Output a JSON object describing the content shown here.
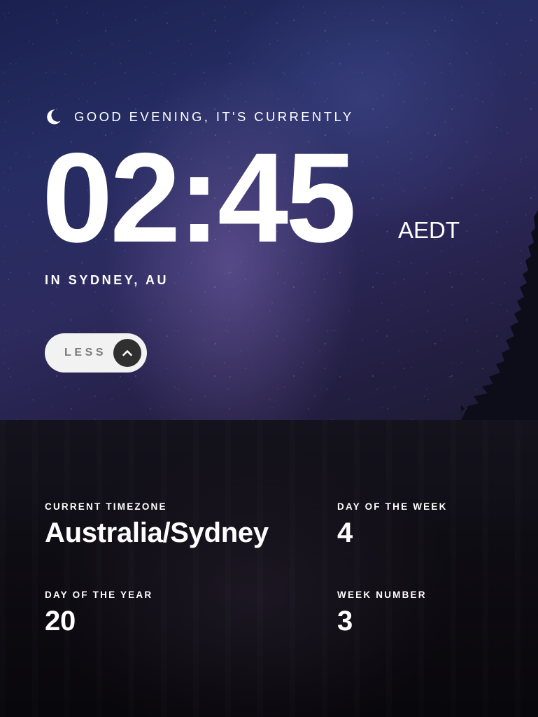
{
  "greeting": {
    "icon": "moon-icon",
    "text": "GOOD EVENING, IT'S CURRENTLY"
  },
  "clock": {
    "time": "02:45",
    "abbreviation": "AEDT"
  },
  "location": "IN SYDNEY, AU",
  "toggle": {
    "label": "LESS",
    "icon": "chevron-up-icon"
  },
  "details": {
    "timezone": {
      "label": "CURRENT TIMEZONE",
      "value": "Australia/Sydney"
    },
    "day_of_week": {
      "label": "DAY OF THE WEEK",
      "value": "4"
    },
    "day_of_year": {
      "label": "DAY OF THE YEAR",
      "value": "20"
    },
    "week_number": {
      "label": "WEEK NUMBER",
      "value": "3"
    }
  },
  "colors": {
    "text": "#ffffff",
    "toggle_bg": "#f2f2f2",
    "toggle_label": "#7a7a7a",
    "toggle_icon_bg": "#303030",
    "details_bg": "#0f0d14"
  }
}
